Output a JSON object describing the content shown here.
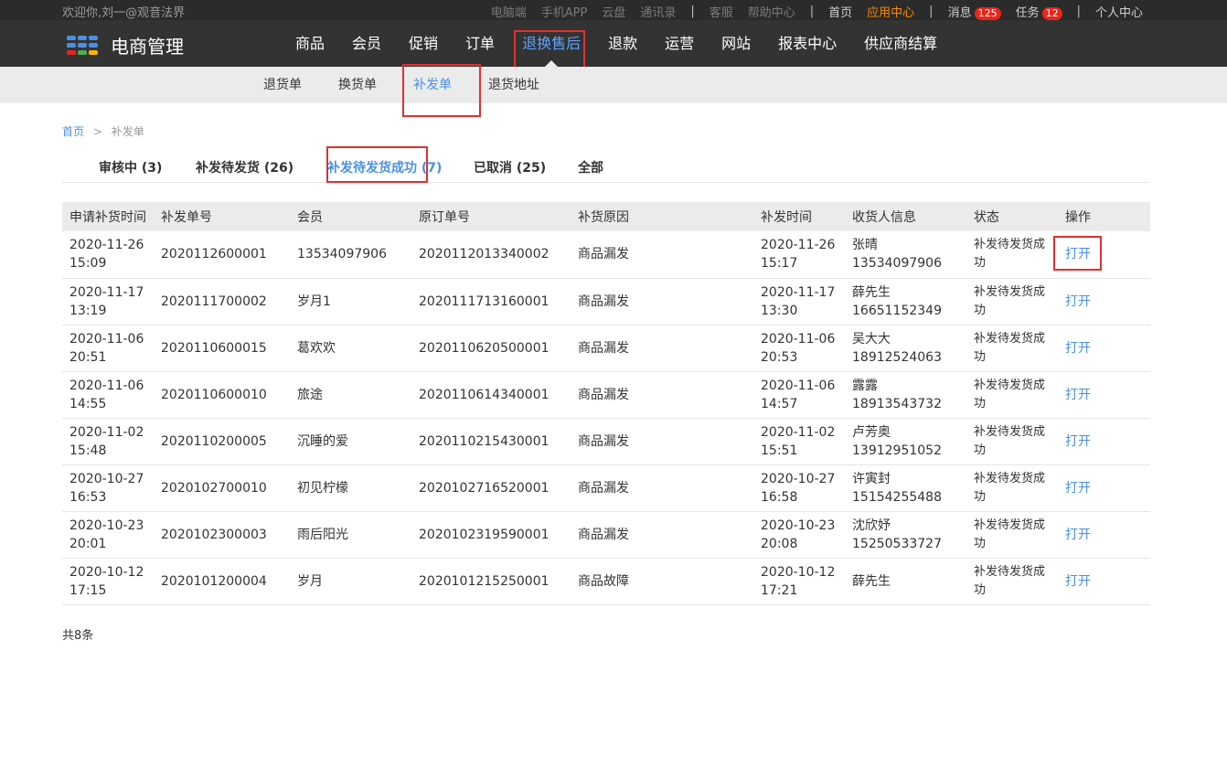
{
  "topbar": {
    "welcome": "欢迎你,刘一@观音法界",
    "links_dim": [
      "电脑端",
      "手机APP",
      "云盘",
      "通讯录"
    ],
    "links_dim2": [
      "客服",
      "帮助中心"
    ],
    "home": "首页",
    "app_center": "应用中心",
    "messages": "消息",
    "messages_count": "125",
    "tasks": "任务",
    "tasks_count": "12",
    "personal": "个人中心",
    "sep": "|"
  },
  "logo": {
    "text": "电商管理",
    "dot_colors": [
      "#4a90e2",
      "#4a90e2",
      "#4a90e2",
      "#4a90e2",
      "#4a90e2",
      "#4a90e2",
      "#e8261b",
      "#4caf50",
      "#ffb300"
    ]
  },
  "nav": {
    "items": [
      "商品",
      "会员",
      "促销",
      "订单",
      "退换售后",
      "退款",
      "运营",
      "网站",
      "报表中心",
      "供应商结算"
    ],
    "active_index": 4
  },
  "subnav": {
    "items": [
      "退货单",
      "换货单",
      "补发单",
      "退货地址"
    ],
    "active_index": 2
  },
  "breadcrumb": {
    "home": "首页",
    "separator": ">",
    "current": "补发单"
  },
  "tabs": {
    "items": [
      "审核中 (3)",
      "补发待发货 (26)",
      "补发待发货成功 (7)",
      "已取消 (25)",
      "全部"
    ],
    "active_index": 2
  },
  "table": {
    "headers": [
      "申请补货时间",
      "补发单号",
      "会员",
      "原订单号",
      "补货原因",
      "补发时间",
      "收货人信息",
      "状态",
      "操作"
    ],
    "rows": [
      {
        "apply_date": "2020-11-26",
        "apply_time": "15:09",
        "no": "2020112600001",
        "member": "13534097906",
        "order_no": "2020112013340002",
        "reason": "商品漏发",
        "ship_date": "2020-11-26",
        "ship_time": "15:17",
        "receiver": "张晴",
        "phone": "13534097906",
        "status_1": "补发待发货成",
        "status_2": "功",
        "op": "打开"
      },
      {
        "apply_date": "2020-11-17",
        "apply_time": "13:19",
        "no": "2020111700002",
        "member": "岁月1",
        "order_no": "2020111713160001",
        "reason": "商品漏发",
        "ship_date": "2020-11-17",
        "ship_time": "13:30",
        "receiver": "薛先生",
        "phone": "16651152349",
        "status_1": "补发待发货成",
        "status_2": "功",
        "op": "打开"
      },
      {
        "apply_date": "2020-11-06",
        "apply_time": "20:51",
        "no": "2020110600015",
        "member": "葛欢欢",
        "order_no": "2020110620500001",
        "reason": "商品漏发",
        "ship_date": "2020-11-06",
        "ship_time": "20:53",
        "receiver": "吴大大",
        "phone": "18912524063",
        "status_1": "补发待发货成",
        "status_2": "功",
        "op": "打开"
      },
      {
        "apply_date": "2020-11-06",
        "apply_time": "14:55",
        "no": "2020110600010",
        "member": "旅途",
        "order_no": "2020110614340001",
        "reason": "商品漏发",
        "ship_date": "2020-11-06",
        "ship_time": "14:57",
        "receiver": "露露",
        "phone": "18913543732",
        "status_1": "补发待发货成",
        "status_2": "功",
        "op": "打开"
      },
      {
        "apply_date": "2020-11-02",
        "apply_time": "15:48",
        "no": "2020110200005",
        "member": "沉睡的爱",
        "order_no": "2020110215430001",
        "reason": "商品漏发",
        "ship_date": "2020-11-02",
        "ship_time": "15:51",
        "receiver": "卢芳奥",
        "phone": "13912951052",
        "status_1": "补发待发货成",
        "status_2": "功",
        "op": "打开"
      },
      {
        "apply_date": "2020-10-27",
        "apply_time": "16:53",
        "no": "2020102700010",
        "member": "初见柠檬",
        "order_no": "2020102716520001",
        "reason": "商品漏发",
        "ship_date": "2020-10-27",
        "ship_time": "16:58",
        "receiver": "许寅封",
        "phone": "15154255488",
        "status_1": "补发待发货成",
        "status_2": "功",
        "op": "打开"
      },
      {
        "apply_date": "2020-10-23",
        "apply_time": "20:01",
        "no": "2020102300003",
        "member": "雨后阳光",
        "order_no": "2020102319590001",
        "reason": "商品漏发",
        "ship_date": "2020-10-23",
        "ship_time": "20:08",
        "receiver": "沈欣妤",
        "phone": "15250533727",
        "status_1": "补发待发货成",
        "status_2": "功",
        "op": "打开"
      },
      {
        "apply_date": "2020-10-12",
        "apply_time": "17:15",
        "no": "2020101200004",
        "member": "岁月",
        "order_no": "2020101215250001",
        "reason": "商品故障",
        "ship_date": "2020-10-12",
        "ship_time": "17:21",
        "receiver": "薛先生",
        "phone": "",
        "status_1": "补发待发货成",
        "status_2": "功",
        "op": "打开"
      }
    ]
  },
  "footer": {
    "total": "共8条"
  },
  "colors": {
    "accent": "#4a90e2",
    "highlight": "#e03030",
    "topbar_bg": "#2b2b2b",
    "nav_bg": "#333333",
    "badge": "#e8261b",
    "app_center": "#ff8a00"
  }
}
